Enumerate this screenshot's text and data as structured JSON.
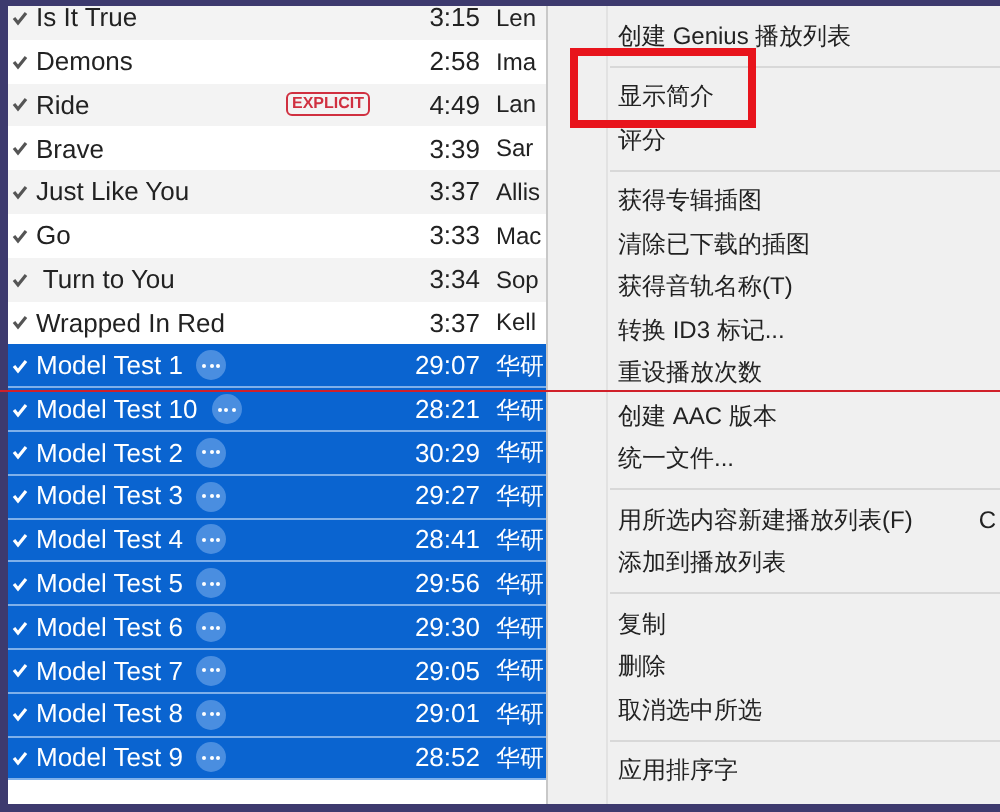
{
  "songs": [
    {
      "name": "Is It True",
      "time": "3:15",
      "artist": "Len",
      "checked": true,
      "selected": false
    },
    {
      "name": "Demons",
      "time": "2:58",
      "artist": "Ima",
      "checked": true,
      "selected": false
    },
    {
      "name": "Ride",
      "badge": "EXPLICIT",
      "time": "4:49",
      "artist": "Lan",
      "checked": true,
      "selected": false
    },
    {
      "name": "Brave",
      "time": "3:39",
      "artist": "Sar",
      "checked": true,
      "selected": false
    },
    {
      "name": "Just Like You",
      "time": "3:37",
      "artist": "Allis",
      "checked": true,
      "selected": false
    },
    {
      "name": "Go",
      "time": "3:33",
      "artist": "Mac",
      "checked": true,
      "selected": false
    },
    {
      "name": " Turn to You",
      "time": "3:34",
      "artist": "Sop",
      "checked": true,
      "selected": false
    },
    {
      "name": "Wrapped In Red",
      "time": "3:37",
      "artist": "Kell",
      "checked": true,
      "selected": false
    },
    {
      "name": "Model Test 1",
      "time": "29:07",
      "artist": "华研",
      "checked": true,
      "selected": true
    },
    {
      "name": "Model Test 10",
      "time": "28:21",
      "artist": "华研",
      "checked": true,
      "selected": true
    },
    {
      "name": "Model Test 2",
      "time": "30:29",
      "artist": "华研",
      "checked": true,
      "selected": true
    },
    {
      "name": "Model Test 3",
      "time": "29:27",
      "artist": "华研",
      "checked": true,
      "selected": true
    },
    {
      "name": "Model Test 4",
      "time": "28:41",
      "artist": "华研",
      "checked": true,
      "selected": true
    },
    {
      "name": "Model Test 5",
      "time": "29:56",
      "artist": "华研",
      "checked": true,
      "selected": true
    },
    {
      "name": "Model Test 6",
      "time": "29:30",
      "artist": "华研",
      "checked": true,
      "selected": true
    },
    {
      "name": "Model Test 7",
      "time": "29:05",
      "artist": "华研",
      "checked": true,
      "selected": true
    },
    {
      "name": "Model Test 8",
      "time": "29:01",
      "artist": "华研",
      "checked": true,
      "selected": true
    },
    {
      "name": "Model Test 9",
      "time": "28:52",
      "artist": "华研",
      "checked": true,
      "selected": true
    }
  ],
  "context_menu": [
    [
      {
        "label": "创建 Genius 播放列表",
        "highlighted": false
      }
    ],
    [
      {
        "label": "显示简介",
        "highlighted": true
      },
      {
        "label": "评分",
        "highlighted": false
      }
    ],
    [
      {
        "label": "获得专辑插图",
        "highlighted": false
      },
      {
        "label": "清除已下载的插图",
        "highlighted": false
      },
      {
        "label": "获得音轨名称(T)",
        "highlighted": false
      },
      {
        "label": "转换 ID3 标记...",
        "highlighted": false
      },
      {
        "label": "重设播放次数",
        "highlighted": false
      },
      {
        "label": "创建 AAC 版本",
        "highlighted": false
      },
      {
        "label": "统一文件...",
        "highlighted": false
      }
    ],
    [
      {
        "label": "用所选内容新建播放列表(F)",
        "shortcut": "C",
        "highlighted": false
      },
      {
        "label": "添加到播放列表",
        "highlighted": false
      }
    ],
    [
      {
        "label": "复制",
        "highlighted": false
      },
      {
        "label": "删除",
        "highlighted": false
      },
      {
        "label": "取消选中所选",
        "highlighted": false
      }
    ],
    [
      {
        "label": "应用排序字",
        "highlighted": false
      }
    ]
  ]
}
